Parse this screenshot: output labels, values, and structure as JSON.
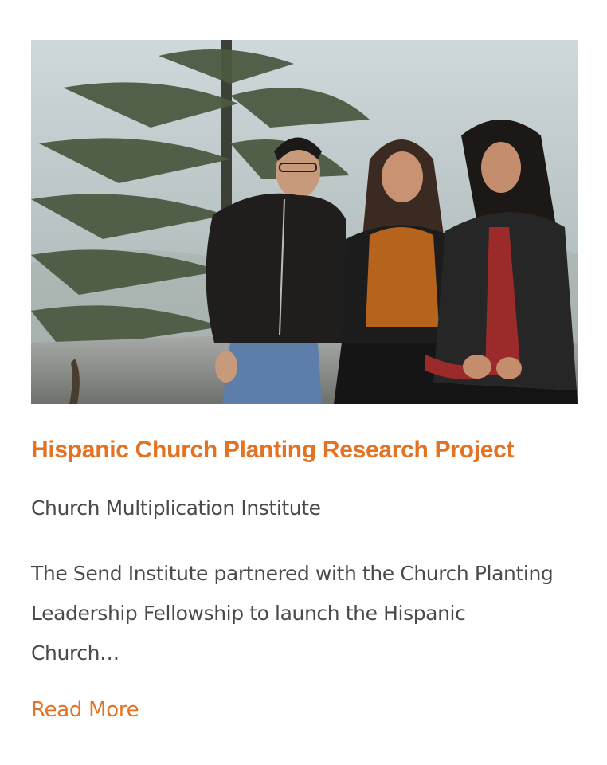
{
  "post": {
    "image_alt": "Three people laughing while sitting on a stone wall in front of misty pine trees",
    "title": "Hispanic Church Planting Research Project",
    "category": "Church Multiplication Institute",
    "excerpt": "The Send Institute partnered with the Church Planting Leadership Fellowship to launch the Hispanic Church…",
    "read_more_label": "Read More"
  },
  "colors": {
    "accent": "#e37222",
    "body_text": "#4a4a4a",
    "background": "#ffffff"
  }
}
